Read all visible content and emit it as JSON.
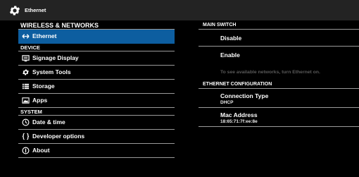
{
  "titlebar": {
    "title": "Ethernet",
    "icon": "gear-icon"
  },
  "left_pane": {
    "header_wireless": "WIRELESS & NETWORKS",
    "ethernet_label": "Ethernet",
    "header_device": "DEVICE",
    "signage_label": "Signage Display",
    "system_tools_label": "System Tools",
    "storage_label": "Storage",
    "apps_label": "Apps",
    "header_system": "SYSTEM",
    "datetime_label": "Date & time",
    "developer_label": "Developer options",
    "about_label": "About"
  },
  "right_pane": {
    "main_switch_header": "MAIN SWITCH",
    "disable_label": "Disable",
    "enable_label": "Enable",
    "hint": "To see available networks, turn Ethernet on.",
    "eth_config_header": "ETHERNET CONFIGURATION",
    "connection_type_label": "Connection Type",
    "connection_type_value": "DHCP",
    "mac_label": "Mac Address",
    "mac_value": "18:65:71:7f:ee:8e"
  },
  "colors": {
    "selected_bg": "#0d5ea0",
    "titlebar_bg": "#232323",
    "hint_text": "#5a5a5a",
    "divider": "#9a9a9a"
  }
}
